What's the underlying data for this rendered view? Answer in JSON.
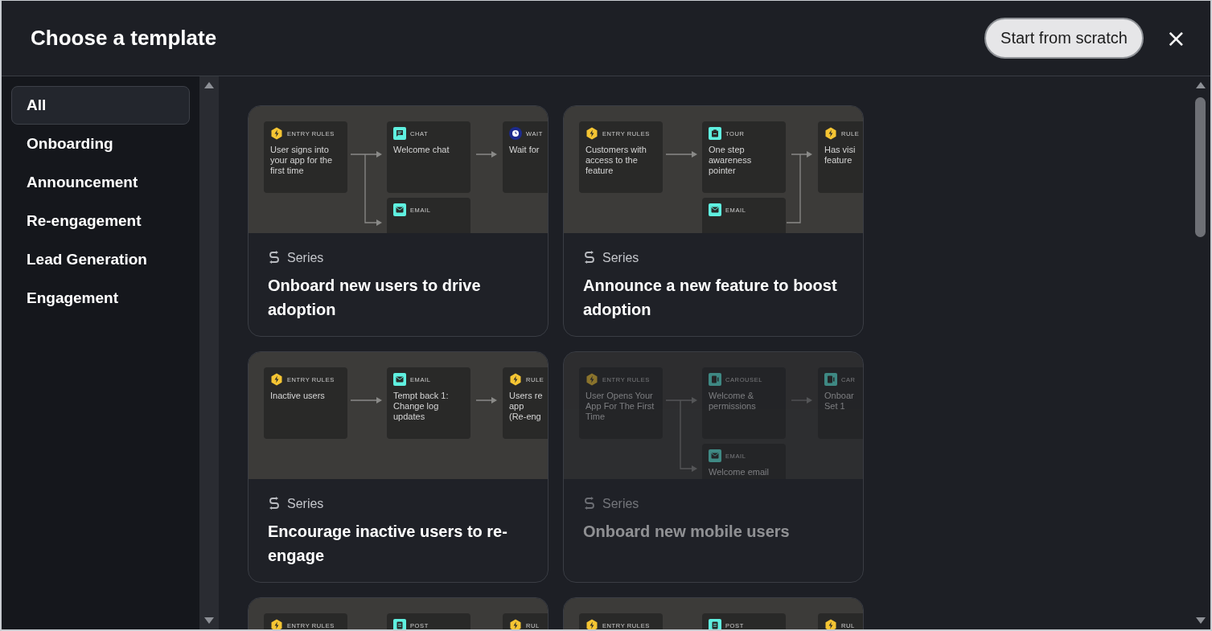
{
  "dialog": {
    "title": "Choose a template",
    "primary_button": "Start from scratch",
    "close_button": "×"
  },
  "sidebar": {
    "items": [
      {
        "label": "All",
        "selected": true
      },
      {
        "label": "Onboarding",
        "selected": false
      },
      {
        "label": "Announcement",
        "selected": false
      },
      {
        "label": "Re-engagement",
        "selected": false
      },
      {
        "label": "Lead Generation",
        "selected": false
      },
      {
        "label": "Engagement",
        "selected": false
      }
    ]
  },
  "templates": [
    {
      "kind": "split",
      "type": "Series",
      "title": "Onboard new users to drive adoption",
      "disabled": false,
      "nodes": [
        {
          "kind": "rule",
          "label": "ENTRY RULES",
          "text": "User signs into your app for the first time"
        },
        {
          "kind": "chat",
          "label": "CHAT",
          "text": "Welcome chat"
        },
        {
          "kind": "wait",
          "label": "WAIT",
          "text": "Wait for"
        },
        {
          "kind": "email",
          "label": "EMAIL"
        }
      ]
    },
    {
      "kind": "join",
      "type": "Series",
      "title": "Announce a new feature to boost adoption",
      "disabled": false,
      "nodes": [
        {
          "kind": "rule",
          "label": "ENTRY RULES",
          "text": "Customers with access to the feature"
        },
        {
          "kind": "tour",
          "label": "TOUR",
          "text": "One step awareness pointer"
        },
        {
          "kind": "rule",
          "label": "RULE",
          "text": "Has visi\nfeature"
        },
        {
          "kind": "email",
          "label": "EMAIL"
        }
      ]
    },
    {
      "kind": "straight",
      "type": "Series",
      "title": "Encourage inactive users to re-engage",
      "disabled": false,
      "nodes": [
        {
          "kind": "rule",
          "label": "ENTRY RULES",
          "text": "Inactive users"
        },
        {
          "kind": "email",
          "label": "EMAIL",
          "text": "Tempt back 1: Change log updates"
        },
        {
          "kind": "rule",
          "label": "RULE",
          "text": "Users re\napp\n(Re-eng"
        }
      ]
    },
    {
      "kind": "split",
      "type": "Series",
      "title": "Onboard new mobile users",
      "disabled": true,
      "nodes": [
        {
          "kind": "rule",
          "label": "ENTRY RULES",
          "text": "User Opens Your App For The First Time"
        },
        {
          "kind": "carousel",
          "label": "CAROUSEL",
          "text": "Welcome & permissions"
        },
        {
          "kind": "carousel",
          "label": "CAR",
          "text": "Onboar\nSet 1"
        },
        {
          "kind": "email",
          "label": "EMAIL",
          "text": "Welcome email"
        }
      ]
    },
    {
      "kind": "none",
      "disabled": false,
      "nodes": [
        {
          "kind": "rule",
          "label": "ENTRY RULES"
        },
        {
          "kind": "post",
          "label": "POST"
        },
        {
          "kind": "rule",
          "label": "RUL"
        }
      ]
    },
    {
      "kind": "none",
      "disabled": false,
      "nodes": [
        {
          "kind": "rule",
          "label": "ENTRY RULES"
        },
        {
          "kind": "post",
          "label": "POST"
        },
        {
          "kind": "rule",
          "label": "RUL"
        }
      ]
    }
  ]
}
